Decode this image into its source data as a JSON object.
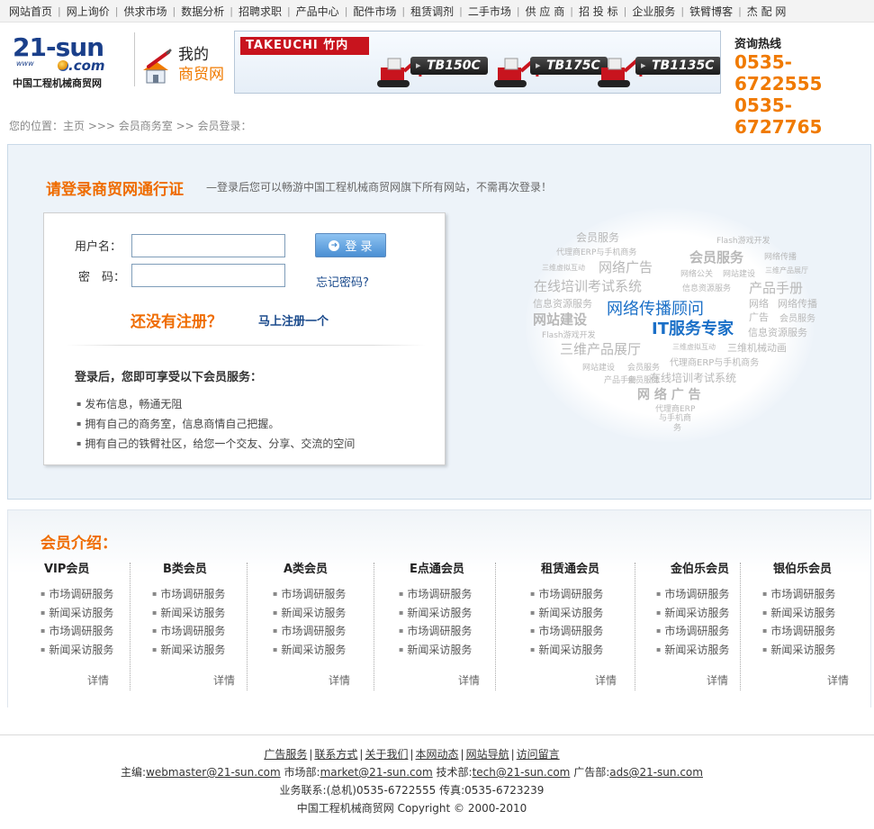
{
  "topnav": {
    "items": [
      "网站首页",
      "网上询价",
      "供求市场",
      "数据分析",
      "招聘求职",
      "产品中心",
      "配件市场",
      "租赁调剂",
      "二手市场",
      "供 应 商",
      "招 投 标",
      "企业服务",
      "铁臂博客",
      "杰 配 网"
    ]
  },
  "header": {
    "logo_main": "21-sun",
    "logo_www": "www",
    "logo_com": ".com",
    "logo_cn": "中国工程机械商贸网",
    "mytrade_line1": "我的",
    "mytrade_line2": "商贸网",
    "banner": {
      "brand": "TAKEUCHI 竹内",
      "models": [
        "TB150C",
        "TB175C",
        "TB1135C"
      ]
    },
    "hotline_title": "资询热线",
    "hotline_numbers": [
      "0535-6722555",
      "0535-6727765"
    ]
  },
  "breadcrumb": "您的位置：主页 >>> 会员商务室 >> 会员登录：",
  "login": {
    "title": "请登录商贸网通行证",
    "subtitle": "—登录后您可以畅游中国工程机械商贸网旗下所有网站，不需再次登录！",
    "username_label": "用户名：",
    "password_label": "密　码：",
    "username_value": "",
    "password_value": "",
    "login_button": "登 录",
    "forgot": "忘记密码?",
    "not_registered": "还没有注册？",
    "register_now": "马上注册一个",
    "benefit_heading": "登录后，您即可享受以下会员服务：",
    "benefits": [
      "发布信息，畅通无阻",
      "拥有自己的商务室，信息商情自己把握。",
      "拥有自己的铁臂社区，给您一个交友、分享、交流的空间"
    ]
  },
  "cloud": {
    "words": [
      "会员服务",
      "Flash游戏开发",
      "代理商ERP与手机商务",
      "会员服务",
      "网络传播",
      "三维虚拟互动",
      "网络广告",
      "网络公关",
      "网站建设",
      "三维产品展厅",
      "在线培训考试系统",
      "信息资源服务",
      "产品手册",
      "信息资源服务",
      "网络传播顾问",
      "网络",
      "网络传播",
      "网站建设",
      "IT服务专家",
      "广告",
      "会员服务",
      "Flash游戏开发",
      "信息资源服务",
      "三维产品展厅",
      "三维虚拟互动",
      "三维机械动画",
      "代理商ERP与手机商务",
      "网站建设",
      "会员服务",
      "产品手册",
      "会员服务",
      "在线培训考试系统",
      "网 络 广 告",
      "代理商ERP",
      "与手机商",
      "务"
    ]
  },
  "members": {
    "title": "会员介绍：",
    "more_label": "详情",
    "columns": [
      {
        "name": "VIP会员",
        "items": [
          "市场调研服务",
          "新闻采访服务",
          "市场调研服务",
          "新闻采访服务"
        ]
      },
      {
        "name": "B类会员",
        "items": [
          "市场调研服务",
          "新闻采访服务",
          "市场调研服务",
          "新闻采访服务"
        ]
      },
      {
        "name": "A类会员",
        "items": [
          "市场调研服务",
          "新闻采访服务",
          "市场调研服务",
          "新闻采访服务"
        ]
      },
      {
        "name": "E点通会员",
        "items": [
          "市场调研服务",
          "新闻采访服务",
          "市场调研服务",
          "新闻采访服务"
        ]
      },
      {
        "name": "租赁通会员",
        "items": [
          "市场调研服务",
          "新闻采访服务",
          "市场调研服务",
          "新闻采访服务"
        ]
      },
      {
        "name": "金伯乐会员",
        "items": [
          "市场调研服务",
          "新闻采访服务",
          "市场调研服务",
          "新闻采访服务"
        ]
      },
      {
        "name": "银伯乐会员",
        "items": [
          "市场调研服务",
          "新闻采访服务",
          "市场调研服务",
          "新闻采访服务"
        ]
      }
    ]
  },
  "footer": {
    "links": [
      "广告服务",
      "联系方式",
      "关于我们",
      "本网动态",
      "网站导航",
      "访问留言"
    ],
    "editor_label": "主编:",
    "editor_email": "webmaster@21-sun.com",
    "market_label": "市场部:",
    "market_email": "market@21-sun.com",
    "tech_label": "技术部:",
    "tech_email": "tech@21-sun.com",
    "ads_label": "广告部:",
    "ads_email": "ads@21-sun.com",
    "contact": "业务联系:(总机)0535-6722555 传真:0535-6723239",
    "copyright": "中国工程机械商贸网 Copyright © 2000-2010"
  }
}
